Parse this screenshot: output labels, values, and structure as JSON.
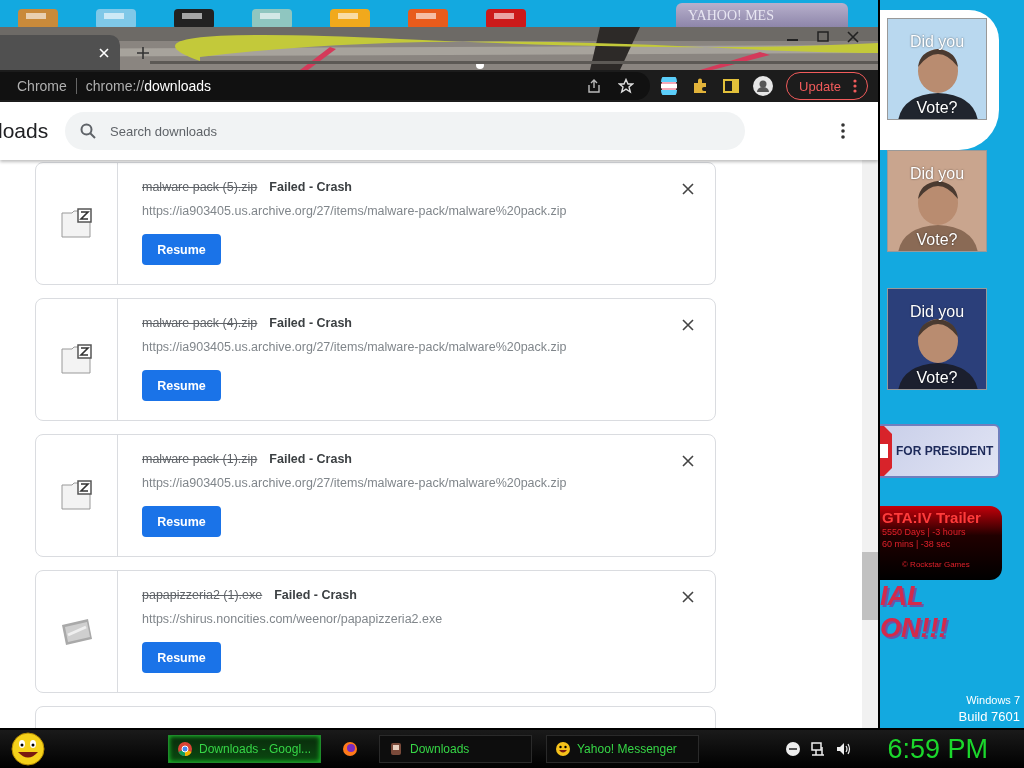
{
  "yahoo_window": {
    "title": "YAHOO! MES"
  },
  "browser": {
    "site_label": "Chrome",
    "url": "chrome://**downloads**",
    "update_button": "Update"
  },
  "page": {
    "title": "loads",
    "search": {
      "placeholder": "Search downloads"
    }
  },
  "downloads": [
    {
      "kind": "zip",
      "file_name": "malware pack (5).zip",
      "status": "Failed - Crash",
      "url": "https://ia903405.us.archive.org/27/items/malware-pack/malware%20pack.zip",
      "button": "Resume"
    },
    {
      "kind": "zip",
      "file_name": "malware pack (4).zip",
      "status": "Failed - Crash",
      "url": "https://ia903405.us.archive.org/27/items/malware-pack/malware%20pack.zip",
      "button": "Resume"
    },
    {
      "kind": "zip",
      "file_name": "malware pack (1).zip",
      "status": "Failed - Crash",
      "url": "https://ia903405.us.archive.org/27/items/malware-pack/malware%20pack.zip",
      "button": "Resume"
    },
    {
      "kind": "exe",
      "file_name": "papapizzeria2 (1).exe",
      "status": "Failed - Crash",
      "url": "https://shirus.noncities.com/weenor/papapizzeria2.exe",
      "button": "Resume"
    }
  ],
  "desktop": {
    "vote_tiles": [
      {
        "line_1": "Did you",
        "line_2": "Vote?"
      },
      {
        "line_1": "Did you",
        "line_2": "Vote?"
      },
      {
        "line_1": "Did you",
        "line_2": "Vote?"
      }
    ],
    "banner": "FOR PRESIDENT",
    "countdown": {
      "title": "GTA:IV  Trailer",
      "line_1": "5550 Days | -3 hours",
      "line_2": "60 mins | -38 sec",
      "credit": "© Rockstar Games"
    },
    "slogan": [
      "IAL",
      "ON!!!"
    ],
    "os_version": [
      "Windows 7",
      "Build 7601"
    ]
  },
  "taskbar": {
    "tasks": [
      {
        "kind": "chrome",
        "label": "Downloads - Googl...",
        "selected": true
      },
      {
        "kind": "firefox",
        "selected": false
      },
      {
        "kind": "app",
        "label": "Downloads",
        "selected": false
      },
      {
        "kind": "yahoo",
        "label": "Yahoo! Messenger",
        "selected": false
      }
    ],
    "clock": "6:59 PM"
  }
}
